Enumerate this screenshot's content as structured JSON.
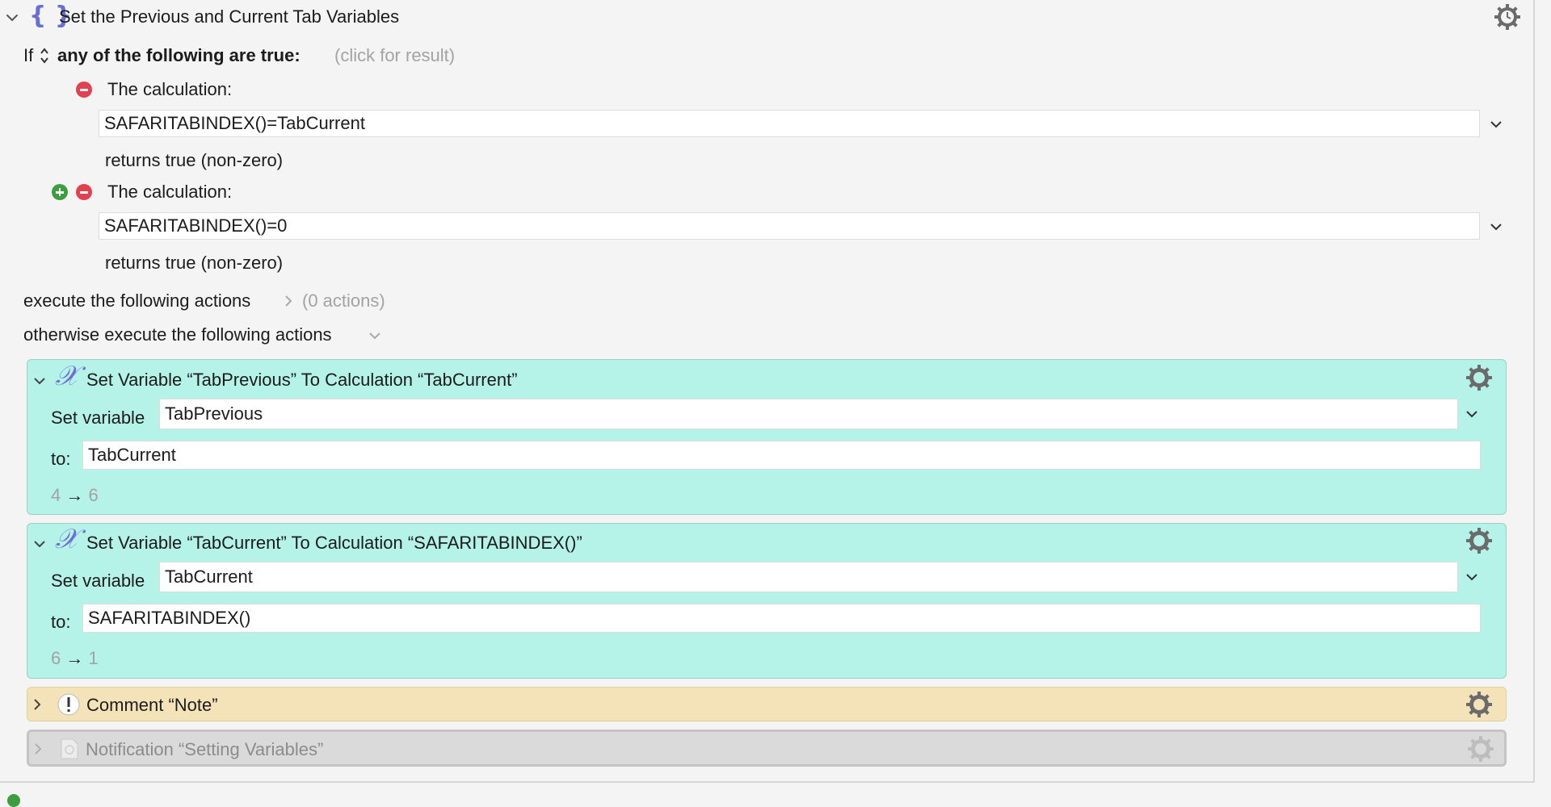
{
  "header": {
    "title": "Set the Previous and Current Tab Variables"
  },
  "condition": {
    "if_label": "If",
    "mode": "any of the following are true:",
    "result_hint": "(click for result)",
    "items": [
      {
        "label": "The calculation:",
        "expression": "SAFARITABINDEX()=TabCurrent",
        "returns": "returns true (non-zero)"
      },
      {
        "label": "The calculation:",
        "expression": "SAFARITABINDEX()=0",
        "returns": "returns true (non-zero)"
      }
    ]
  },
  "then_block": {
    "label": "execute the following actions",
    "count": "(0 actions)"
  },
  "else_block": {
    "label": "otherwise execute the following actions"
  },
  "actions": [
    {
      "title": "Set Variable “TabPrevious” To Calculation “TabCurrent”",
      "set_label": "Set variable",
      "variable": "TabPrevious",
      "to_label": "to:",
      "value": "TabCurrent",
      "result_from": "4",
      "arrow": "→",
      "result_to": "6"
    },
    {
      "title": "Set Variable “TabCurrent” To Calculation “SAFARITABINDEX()”",
      "set_label": "Set variable",
      "variable": "TabCurrent",
      "to_label": "to:",
      "value": "SAFARITABINDEX()",
      "result_from": "6",
      "arrow": "→",
      "result_to": "1"
    }
  ],
  "comment": {
    "title": "Comment “Note”"
  },
  "notification": {
    "title": "Notification “Setting Variables”"
  },
  "colors": {
    "action_bg": "#b5f2e8",
    "comment_bg": "#f4e3b8",
    "disabled_bg": "#dadada",
    "icon_accent": "#6a6fd6",
    "remove_red": "#e0434f",
    "add_green": "#3e9d3e"
  },
  "icons": [
    "chevron-down-icon",
    "braces-icon",
    "gear-clock-icon",
    "updown-arrows-icon",
    "remove-icon",
    "add-icon",
    "chevron-right-icon",
    "variable-x-icon",
    "gear-icon",
    "comment-icon",
    "notification-icon"
  ]
}
